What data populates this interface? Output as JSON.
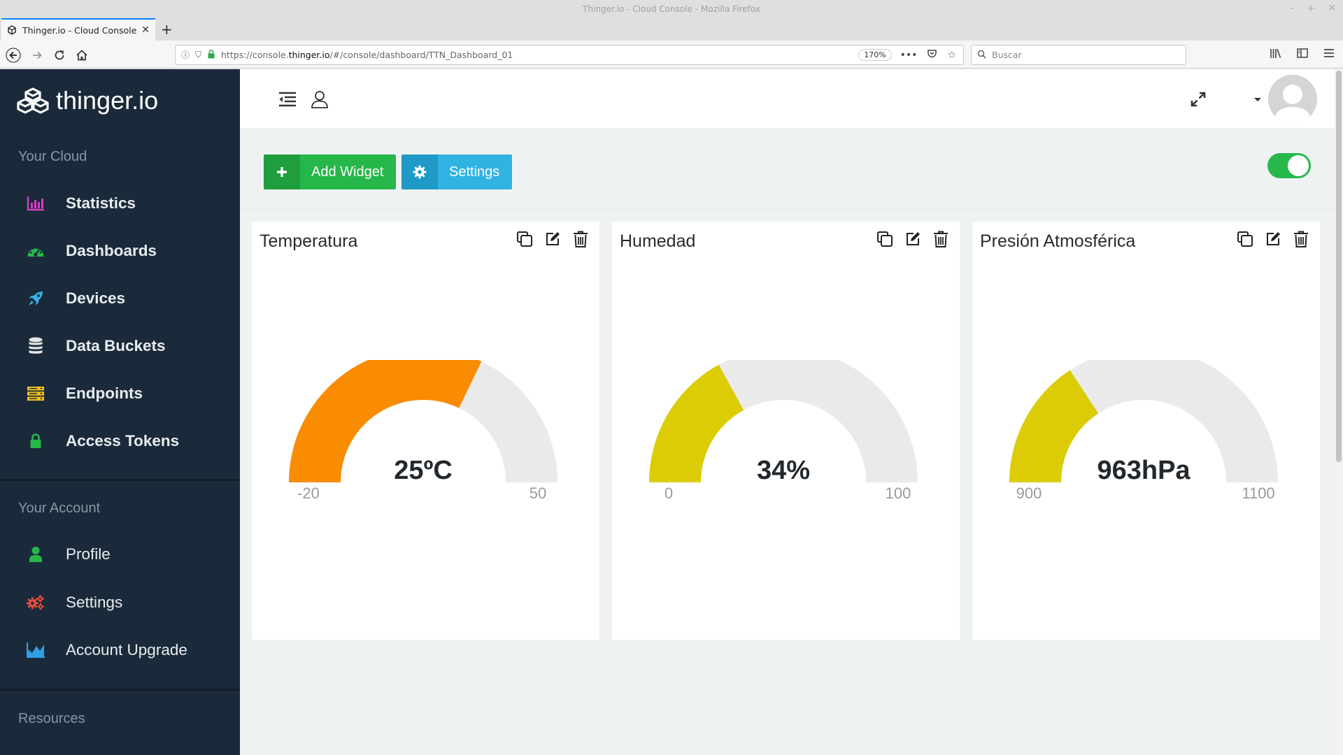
{
  "browser": {
    "window_title": "Thinger.io - Cloud Console - Mozilla Firefox",
    "tab_title": "Thinger.io - Cloud Console",
    "url_prefix": "https://console.",
    "url_domain": "thinger.io",
    "url_suffix": "/#/console/dashboard/TTN_Dashboard_01",
    "zoom": "170%",
    "search_placeholder": "Buscar"
  },
  "sidebar": {
    "logo": "thinger.io",
    "section_cloud": "Your Cloud",
    "cloud_items": [
      {
        "label": "Statistics",
        "icon": "bar-chart-icon",
        "color": "#d63fc3"
      },
      {
        "label": "Dashboards",
        "icon": "dashboard-icon",
        "color": "#27b84a"
      },
      {
        "label": "Devices",
        "icon": "rocket-icon",
        "color": "#30b2e2"
      },
      {
        "label": "Data Buckets",
        "icon": "database-icon",
        "color": "#e6e6e6"
      },
      {
        "label": "Endpoints",
        "icon": "server-icon",
        "color": "#f2c21b"
      },
      {
        "label": "Access Tokens",
        "icon": "lock-icon",
        "color": "#27b84a"
      }
    ],
    "section_account": "Your Account",
    "account_items": [
      {
        "label": "Profile",
        "icon": "user-icon",
        "color": "#27b84a"
      },
      {
        "label": "Settings",
        "icon": "gears-icon",
        "color": "#e84c3d"
      },
      {
        "label": "Account Upgrade",
        "icon": "area-chart-icon",
        "color": "#30a0e6"
      }
    ],
    "section_resources": "Resources"
  },
  "toolbar": {
    "add_widget_label": "Add Widget",
    "settings_label": "Settings"
  },
  "widgets": [
    {
      "title": "Temperatura",
      "value": 25,
      "display": "25ºC",
      "min": -20,
      "max": 50,
      "min_label": "-20",
      "max_label": "50",
      "color": "#f98c00"
    },
    {
      "title": "Humedad",
      "value": 34,
      "display": "34%",
      "min": 0,
      "max": 100,
      "min_label": "0",
      "max_label": "100",
      "color": "#dccc06"
    },
    {
      "title": "Presión Atmosférica",
      "value": 963,
      "display": "963hPa",
      "min": 900,
      "max": 1100,
      "min_label": "900",
      "max_label": "1100",
      "color": "#dccc06"
    }
  ],
  "colors": {
    "sidebar_bg": "#1b2a3a",
    "gauge_track": "#ebeaea",
    "accent_green": "#27b84a",
    "accent_blue": "#30b2e2"
  }
}
